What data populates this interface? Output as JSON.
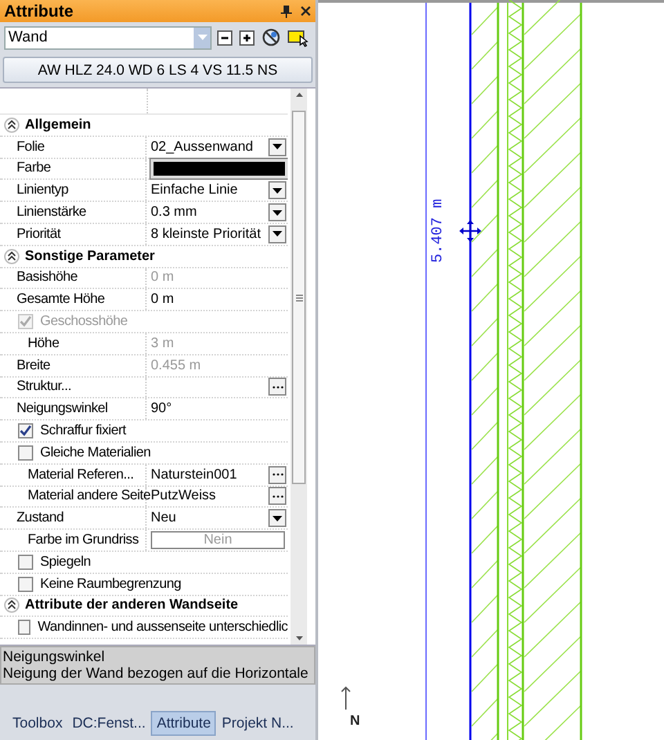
{
  "panel": {
    "title": "Attribute",
    "element_type": "Wand",
    "wall_type": "AW HLZ 24.0 WD 6 LS 4 VS 11.5 NS",
    "properties": [
      {
        "kind": "section",
        "label": "Allgemein",
        "expanded": true,
        "children": [
          {
            "kind": "dropdown",
            "label": "Folie",
            "value": "02_Aussenwand"
          },
          {
            "kind": "color",
            "label": "Farbe",
            "color": "#000000"
          },
          {
            "kind": "dropdown",
            "label": "Linientyp",
            "value": "Einfache Linie"
          },
          {
            "kind": "dropdown",
            "label": "Linienstärke",
            "value": "0.3 mm"
          },
          {
            "kind": "dropdown",
            "label": "Priorität",
            "value": "8 kleinste Priorität"
          }
        ]
      },
      {
        "kind": "section",
        "label": "Sonstige Parameter",
        "expanded": true,
        "children": [
          {
            "kind": "text",
            "label": "Basishöhe",
            "value": "0 m",
            "disabled": true
          },
          {
            "kind": "text",
            "label": "Gesamte Höhe",
            "value": "0 m",
            "disabled": false
          },
          {
            "kind": "checkbox",
            "label": "Geschosshöhe",
            "checked": true,
            "disabled": true,
            "children": [
              {
                "kind": "text",
                "label": "Höhe",
                "value": "3 m",
                "disabled": true
              }
            ]
          },
          {
            "kind": "text",
            "label": "Breite",
            "value": "0.455 m",
            "disabled": true
          },
          {
            "kind": "browse",
            "label": "Struktur..."
          },
          {
            "kind": "text",
            "label": "Neigungswinkel",
            "value": "90°",
            "disabled": false
          },
          {
            "kind": "checkbox",
            "label": "Schraffur fixiert",
            "checked": true,
            "disabled": false
          },
          {
            "kind": "checkbox",
            "label": "Gleiche Materialien",
            "checked": false,
            "disabled": false,
            "children": [
              {
                "kind": "browse",
                "label": "Material Referen...",
                "value": "Naturstein001"
              },
              {
                "kind": "browse",
                "label": "Material andere Seite",
                "value": "PutzWeiss"
              }
            ]
          },
          {
            "kind": "dropdown",
            "label": "Zustand",
            "value": "Neu",
            "children": [
              {
                "kind": "button",
                "label": "Farbe im Grundriss",
                "value": "Nein"
              }
            ]
          },
          {
            "kind": "checkbox",
            "label": "Spiegeln",
            "checked": false,
            "disabled": false
          },
          {
            "kind": "checkbox",
            "label": "Keine Raumbegrenzung",
            "checked": false,
            "disabled": false
          }
        ]
      },
      {
        "kind": "section",
        "label": "Attribute der anderen Wandseite",
        "expanded": true,
        "children": [
          {
            "kind": "checkbox",
            "label": "Wandinnen- und aussenseite unterschiedlic",
            "checked": false,
            "disabled": false
          }
        ]
      }
    ],
    "description": {
      "title": "Neigungswinkel",
      "text": "Neigung der Wand bezogen auf die Horizontale"
    },
    "tabs": [
      {
        "label": "Toolbox",
        "selected": false
      },
      {
        "label": "DC:Fenst...",
        "selected": false
      },
      {
        "label": "Attribute",
        "selected": true
      },
      {
        "label": "Projekt N...",
        "selected": false
      }
    ]
  },
  "canvas": {
    "dimension": "5.407 m",
    "north_label": "N"
  }
}
